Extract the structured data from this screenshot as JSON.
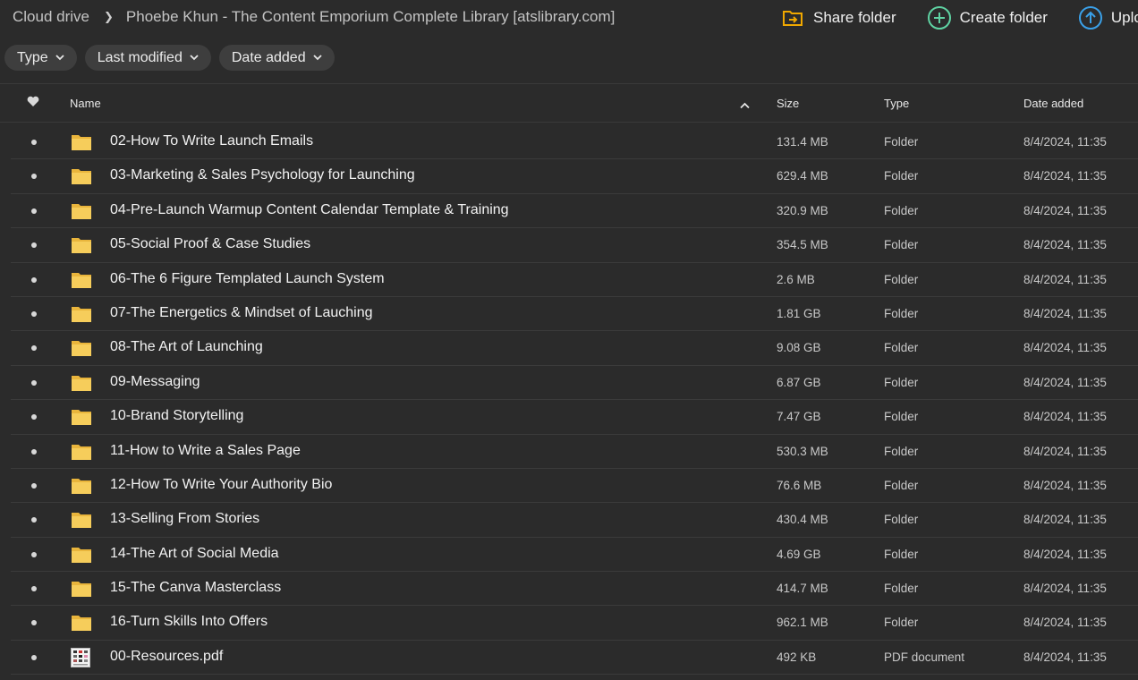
{
  "breadcrumb": {
    "root": "Cloud drive",
    "current": "Phoebe Khun - The Content Emporium Complete Library [atslibrary.com]"
  },
  "actions": {
    "share_folder": "Share folder",
    "create_folder": "Create folder",
    "upload": "Uplo"
  },
  "filters": {
    "type": "Type",
    "last_modified": "Last modified",
    "date_added": "Date added"
  },
  "columns": {
    "name": "Name",
    "size": "Size",
    "type": "Type",
    "date_added": "Date added"
  },
  "colors": {
    "background": "#2b2b2b",
    "folder": "#f4c54a",
    "share_icon": "#f0a800",
    "create_icon": "#5fd3a3",
    "upload_icon": "#3aa0e8"
  },
  "rows": [
    {
      "name": "02-How To Write Launch Emails",
      "size": "131.4 MB",
      "type": "Folder",
      "date": "8/4/2024, 11:35",
      "icon": "folder-icon"
    },
    {
      "name": "03-Marketing & Sales Psychology for Launching",
      "size": "629.4 MB",
      "type": "Folder",
      "date": "8/4/2024, 11:35",
      "icon": "folder-icon"
    },
    {
      "name": "04-Pre-Launch Warmup Content Calendar Template & Training",
      "size": "320.9 MB",
      "type": "Folder",
      "date": "8/4/2024, 11:35",
      "icon": "folder-icon"
    },
    {
      "name": "05-Social Proof & Case Studies",
      "size": "354.5 MB",
      "type": "Folder",
      "date": "8/4/2024, 11:35",
      "icon": "folder-icon"
    },
    {
      "name": "06-The 6 Figure Templated Launch System",
      "size": "2.6 MB",
      "type": "Folder",
      "date": "8/4/2024, 11:35",
      "icon": "folder-icon"
    },
    {
      "name": "07-The Energetics & Mindset of Lauching",
      "size": "1.81 GB",
      "type": "Folder",
      "date": "8/4/2024, 11:35",
      "icon": "folder-icon"
    },
    {
      "name": "08-The Art of Launching",
      "size": "9.08 GB",
      "type": "Folder",
      "date": "8/4/2024, 11:35",
      "icon": "folder-icon"
    },
    {
      "name": "09-Messaging",
      "size": "6.87 GB",
      "type": "Folder",
      "date": "8/4/2024, 11:35",
      "icon": "folder-icon"
    },
    {
      "name": "10-Brand Storytelling",
      "size": "7.47 GB",
      "type": "Folder",
      "date": "8/4/2024, 11:35",
      "icon": "folder-icon"
    },
    {
      "name": "11-How to Write a Sales Page",
      "size": "530.3 MB",
      "type": "Folder",
      "date": "8/4/2024, 11:35",
      "icon": "folder-icon"
    },
    {
      "name": "12-How To Write Your Authority Bio",
      "size": "76.6 MB",
      "type": "Folder",
      "date": "8/4/2024, 11:35",
      "icon": "folder-icon"
    },
    {
      "name": "13-Selling From Stories",
      "size": "430.4 MB",
      "type": "Folder",
      "date": "8/4/2024, 11:35",
      "icon": "folder-icon"
    },
    {
      "name": "14-The Art of Social Media",
      "size": "4.69 GB",
      "type": "Folder",
      "date": "8/4/2024, 11:35",
      "icon": "folder-icon"
    },
    {
      "name": "15-The Canva Masterclass",
      "size": "414.7 MB",
      "type": "Folder",
      "date": "8/4/2024, 11:35",
      "icon": "folder-icon"
    },
    {
      "name": "16-Turn Skills Into Offers",
      "size": "962.1 MB",
      "type": "Folder",
      "date": "8/4/2024, 11:35",
      "icon": "folder-icon"
    },
    {
      "name": "00-Resources.pdf",
      "size": "492 KB",
      "type": "PDF document",
      "date": "8/4/2024, 11:35",
      "icon": "pdf-thumbnail-icon"
    }
  ]
}
